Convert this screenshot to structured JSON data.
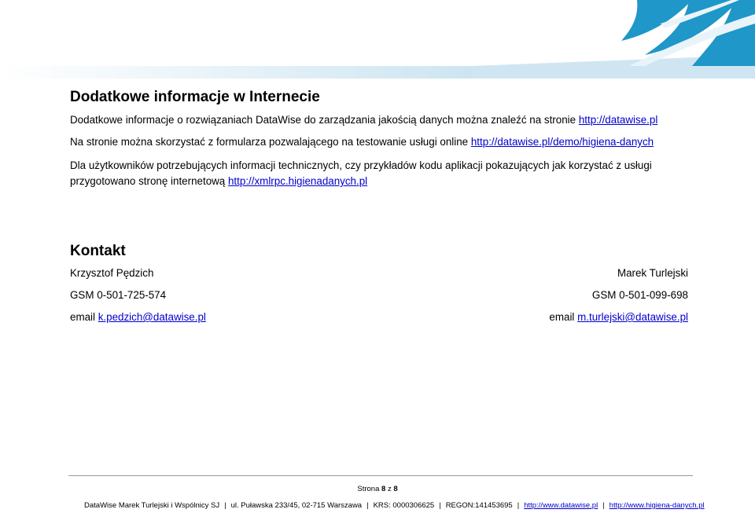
{
  "colors": {
    "link": "#0000cc",
    "logo_blue": "#1f97c8",
    "logo_light": "#cfe6f2",
    "rule": "#9a9a9a"
  },
  "logo": {
    "icon": "bird-swoosh-icon"
  },
  "internet": {
    "heading": "Dodatkowe informacje w Internecie",
    "line1_text": "Dodatkowe informacje o rozwiązaniach DataWise do zarządzania jakością danych można znaleźć na stronie ",
    "line1_link": "http://datawise.pl",
    "line2_text": "Na stronie można skorzystać z formularza pozwalającego na testowanie usługi online ",
    "line2_link": "http://datawise.pl/demo/higiena-danych",
    "line3_text": "Dla użytkowników potrzebujących informacji technicznych, czy przykładów kodu aplikacji pokazujących jak korzystać z usługi przygotowano stronę internetową ",
    "line3_link": "http://xmlrpc.higienadanych.pl"
  },
  "contact": {
    "heading": "Kontakt",
    "left": {
      "name": "Krzysztof Pędzich",
      "phone": "GSM 0-501-725-574",
      "email_label": "email ",
      "email": "k.pedzich@datawise.pl"
    },
    "right": {
      "name": "Marek Turlejski",
      "phone": "GSM 0-501-099-698",
      "email_label": "email ",
      "email": "m.turlejski@datawise.pl"
    }
  },
  "page": {
    "label": "Strona",
    "current": "8",
    "of": "z",
    "total": "8"
  },
  "footer": {
    "company": "DataWise Marek Turlejski i Wspólnicy SJ",
    "address": "ul. Puławska 233/45, 02-715 Warszawa",
    "krs": "KRS: 0000306625",
    "regon": "REGON:141453695",
    "sep": "|",
    "link1": "http://www.datawise.pl",
    "link2": "http://www.higiena-danych.pl"
  }
}
